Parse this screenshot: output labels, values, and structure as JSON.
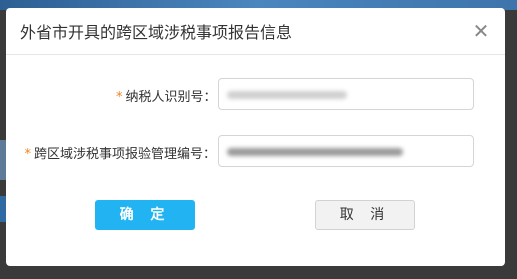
{
  "dialog": {
    "title": "外省市开具的跨区域涉税事项报告信息",
    "close_glyph": "✕"
  },
  "form": {
    "required_mark": "*",
    "taxpayer_id": {
      "label": "纳税人识别号：",
      "value": ""
    },
    "report_no": {
      "label": "跨区域涉税事项报验管理编号：",
      "value": ""
    }
  },
  "buttons": {
    "confirm": "确 定",
    "cancel": "取 消"
  }
}
